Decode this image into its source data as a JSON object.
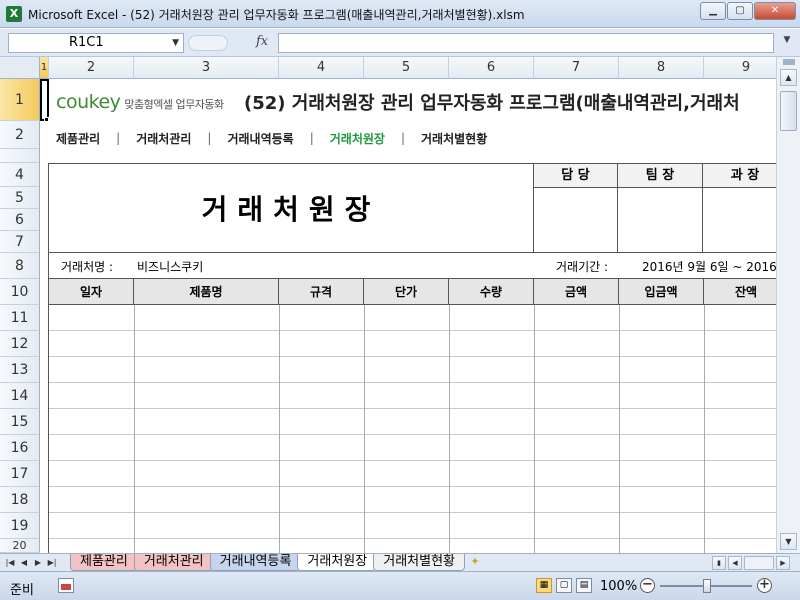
{
  "window": {
    "app_icon": "X",
    "title": "Microsoft Excel - (52) 거래처원장 관리 업무자동화 프로그램(매출내역관리,거래처별현황).xlsm",
    "min_label": "▁",
    "max_label": "▢",
    "close_label": "✕"
  },
  "formula_bar": {
    "name_box": "R1C1",
    "fx_label": "fx",
    "formula": ""
  },
  "columns": [
    "1",
    "2",
    "3",
    "4",
    "5",
    "6",
    "7",
    "8",
    "9"
  ],
  "rows": [
    "1",
    "2",
    "4",
    "5",
    "6",
    "7",
    "8",
    "10",
    "11",
    "12",
    "13",
    "14",
    "15",
    "16",
    "17",
    "18",
    "19",
    "20"
  ],
  "sheet": {
    "logo": "coukey",
    "logo_sub": "맞춤형엑셀 업무자동화",
    "doc_title": "(52) 거래처원장 관리 업무자동화 프로그램(매출내역관리,거래처",
    "menu": [
      "제품관리",
      "거래처관리",
      "거래내역등록",
      "거래처원장",
      "거래처별현황"
    ],
    "menu_separator": "|",
    "form_title": "거래처원장",
    "approvals": [
      "담 당",
      "팀 장",
      "과 장"
    ],
    "client_label": "거래처명 :",
    "client_name": "비즈니스쿠키",
    "period_label": "거래기간 :",
    "period_value": "2016년 9월 6일 ~ 2016",
    "table_headers": [
      "일자",
      "제품명",
      "규격",
      "단가",
      "수량",
      "금액",
      "입금액",
      "잔액"
    ]
  },
  "sheet_tabs": [
    "제품관리",
    "거래처관리",
    "거래내역등록",
    "거래처원장",
    "거래처별현황"
  ],
  "status": {
    "ready": "준비",
    "zoom": "100%",
    "zoom_minus": "−",
    "zoom_plus": "+"
  }
}
